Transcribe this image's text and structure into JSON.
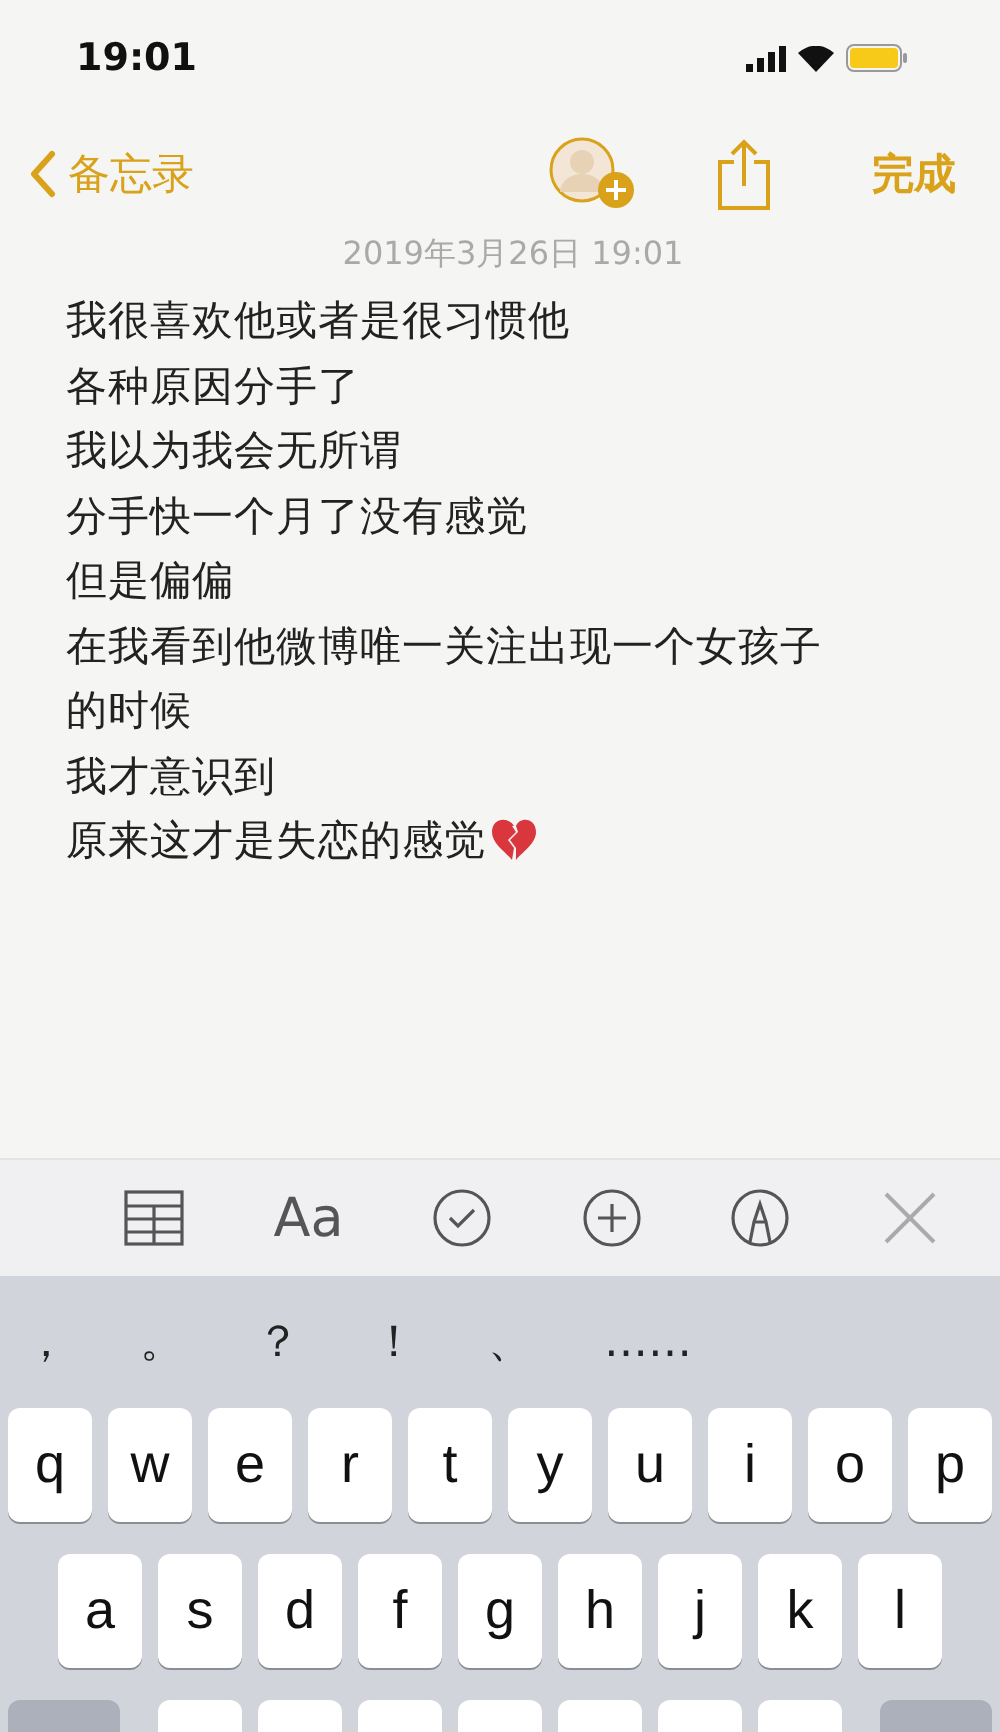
{
  "status_bar": {
    "time": "19:01"
  },
  "nav": {
    "back": "备忘录",
    "done": "完成"
  },
  "note": {
    "date": "2019年3月26日 19:01",
    "lines": [
      "我很喜欢他或者是很习惯他",
      "各种原因分手了",
      "我以为我会无所谓",
      "分手快一个月了没有感觉",
      "但是偏偏",
      "在我看到他微博唯一关注出现一个女孩子",
      "的时候",
      "我才意识到",
      "原来这才是失恋的感觉"
    ]
  },
  "toolbar": {
    "format_label": "Aa"
  },
  "keyboard": {
    "suggestions": [
      "，",
      "。",
      "？",
      "！",
      "、",
      "……"
    ],
    "rows": [
      [
        "q",
        "w",
        "e",
        "r",
        "t",
        "y",
        "u",
        "i",
        "o",
        "p"
      ],
      [
        "a",
        "s",
        "d",
        "f",
        "g",
        "h",
        "j",
        "k",
        "l"
      ]
    ]
  }
}
